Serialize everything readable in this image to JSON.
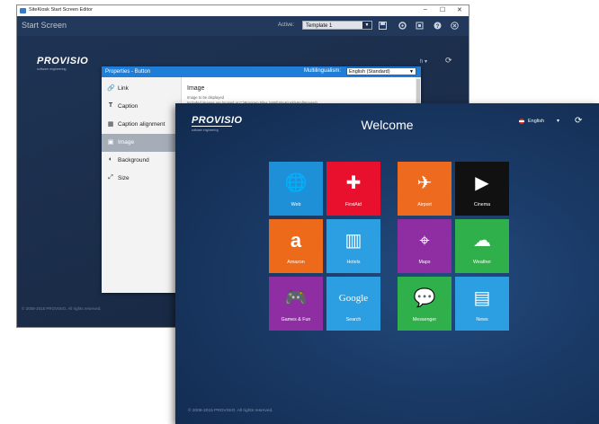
{
  "editor": {
    "window_title": "SiteKiosk Start Screen Editor",
    "window_controls": [
      "–",
      "☐",
      "✕"
    ],
    "toolbar": {
      "title": "Start Screen",
      "active_label": "Active:",
      "template_value": "Template 1",
      "icons": [
        "save-icon",
        "settings-icon",
        "fullscreen-icon",
        "help-icon",
        "close-icon"
      ]
    },
    "preview": {
      "logo": "PROVISIO",
      "logo_sub": "software engineering",
      "copyright": "© 2008-2015 PROVISIO. All rights reserved.",
      "ghost_lang": "h ▾",
      "ghost_signout": "⟳"
    }
  },
  "properties": {
    "title": "Properties - Button",
    "multilingualism_label": "Multilingualism:",
    "multilingualism_value": "English (Standard)",
    "sidebar": [
      {
        "label": "Link",
        "icon": "link-icon",
        "glyph": "🔗"
      },
      {
        "label": "Caption",
        "icon": "text-icon",
        "glyph": "T"
      },
      {
        "label": "Caption alignment",
        "icon": "alignment-icon",
        "glyph": "▦"
      },
      {
        "label": "Image",
        "icon": "image-icon",
        "glyph": "▣"
      },
      {
        "label": "Background",
        "icon": "background-icon",
        "glyph": "◐"
      },
      {
        "label": "Size",
        "icon": "size-icon",
        "glyph": "⤢"
      }
    ],
    "active_item": "Image",
    "content": {
      "heading": "Image",
      "desc1": "Image to be displayed",
      "desc2": "Included images are located at C:\\Program Files (x86)\\SiteKiosk\\Html\\Images\\..."
    }
  },
  "start_screen": {
    "logo": "PROVISIO",
    "logo_sub": "software engineering",
    "welcome": "Welcome",
    "language": "English",
    "copyright": "© 2008-2015 PROVISIO. All rights reserved.",
    "tiles": [
      {
        "label": "Web",
        "color": "#1e90d8",
        "glyph": "🌐",
        "icon": "globe-icon"
      },
      {
        "label": "FirstAid",
        "color": "#e8102c",
        "glyph": "✚",
        "icon": "first-aid-icon"
      },
      {
        "label": "Airport",
        "color": "#ed6a1f",
        "glyph": "✈",
        "icon": "airplane-icon"
      },
      {
        "label": "Cinema",
        "color": "#111111",
        "glyph": "▶",
        "icon": "clapperboard-icon"
      },
      {
        "label": "Amazon",
        "color": "#ee6a1b",
        "glyph": "a",
        "icon": "amazon-icon"
      },
      {
        "label": "Hotels",
        "color": "#2b9fe2",
        "glyph": "▥",
        "icon": "building-icon"
      },
      {
        "label": "Maps",
        "color": "#8e2ea2",
        "glyph": "⌖",
        "icon": "map-pin-icon"
      },
      {
        "label": "Weather",
        "color": "#2fb04a",
        "glyph": "☁",
        "icon": "cloud-sun-icon"
      },
      {
        "label": "Games & Fun",
        "color": "#8e2ea2",
        "glyph": "🎮",
        "icon": "gamepad-icon"
      },
      {
        "label": "Search",
        "color": "#2b9fe2",
        "glyph": "Google",
        "icon": "google-icon"
      },
      {
        "label": "Messenger",
        "color": "#2fb04a",
        "glyph": "💬",
        "icon": "chat-icon"
      },
      {
        "label": "News",
        "color": "#2b9fe2",
        "glyph": "▤",
        "icon": "newspaper-icon"
      }
    ]
  }
}
